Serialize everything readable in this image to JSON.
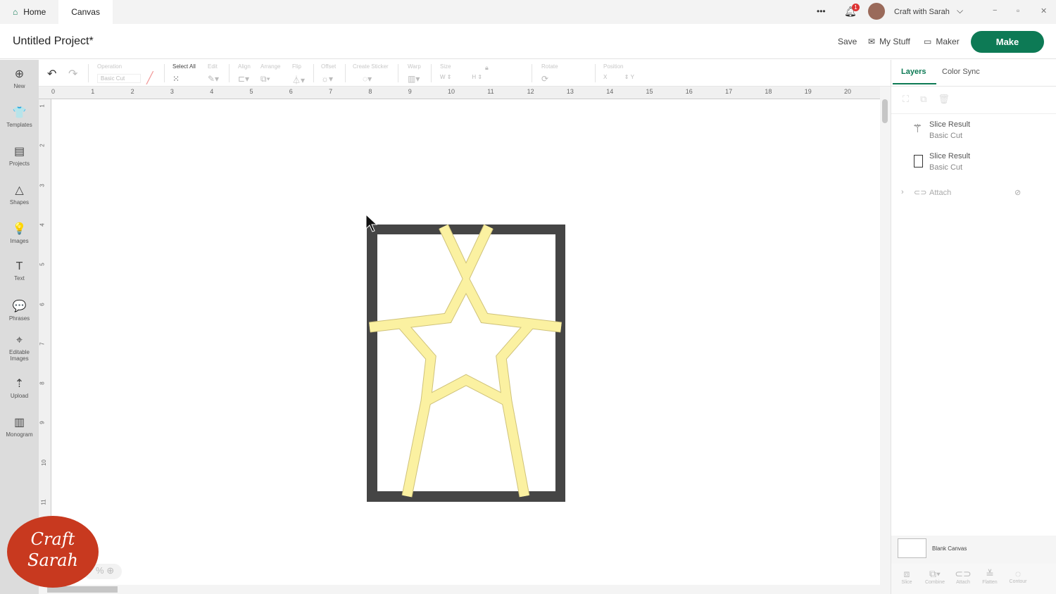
{
  "titlebar": {
    "tabs": [
      {
        "label": "Home",
        "icon": "home-icon"
      },
      {
        "label": "Canvas"
      }
    ],
    "more": "•••",
    "notifications": "1",
    "user": "Craft with Sarah",
    "window": {
      "minimize": "−",
      "restore": "▫",
      "close": "✕"
    }
  },
  "header": {
    "title": "Untitled Project*",
    "save": "Save",
    "my_stuff": "My Stuff",
    "maker": "Maker",
    "make": "Make",
    "accent": "#0d7a55"
  },
  "sidebar": {
    "items": [
      {
        "label": "New",
        "icon": "⊕"
      },
      {
        "label": "Templates",
        "icon": "👕"
      },
      {
        "label": "Projects",
        "icon": "▤"
      },
      {
        "label": "Shapes",
        "icon": "△"
      },
      {
        "label": "Images",
        "icon": "💡"
      },
      {
        "label": "Text",
        "icon": "T"
      },
      {
        "label": "Phrases",
        "icon": "💬"
      },
      {
        "label": "Editable Images",
        "icon": "⌖"
      },
      {
        "label": "Upload",
        "icon": "⇡"
      },
      {
        "label": "Monogram",
        "icon": "▥"
      }
    ]
  },
  "toolbar": {
    "operation_label": "Operation",
    "operation_value": "Basic Cut",
    "select_all": "Select All",
    "edit": "Edit",
    "align": "Align",
    "arrange": "Arrange",
    "flip": "Flip",
    "offset": "Offset",
    "create_sticker": "Create Sticker",
    "warp": "Warp",
    "size": "Size",
    "w": "W",
    "h": "H",
    "rotate": "Rotate",
    "position": "Position",
    "x": "X",
    "y": "Y"
  },
  "ruler": {
    "h": [
      "0",
      "1",
      "2",
      "3",
      "4",
      "5",
      "6",
      "7",
      "8",
      "9",
      "10",
      "11",
      "12",
      "13",
      "14",
      "15",
      "16",
      "17",
      "18",
      "19",
      "20"
    ],
    "v": [
      "1",
      "2",
      "3",
      "4",
      "5",
      "6",
      "7",
      "8",
      "9",
      "10",
      "11"
    ]
  },
  "zoom": {
    "unit": "%"
  },
  "panel": {
    "tabs": [
      "Layers",
      "Color Sync"
    ],
    "layers": [
      {
        "name": "Slice Result",
        "op": "Basic Cut",
        "icon": "star-figure-icon"
      },
      {
        "name": "Slice Result",
        "op": "Basic Cut",
        "icon": "rectangle-icon"
      }
    ],
    "group": "Attach",
    "canvas": "Blank Canvas",
    "actions": [
      "Slice",
      "Combine",
      "Attach",
      "Flatten",
      "Contour"
    ]
  },
  "logo": {
    "text": "Craft with Sarah",
    "color": "#c8391f"
  },
  "colors": {
    "frame": "#454545",
    "strips": "#fbf1a1"
  }
}
